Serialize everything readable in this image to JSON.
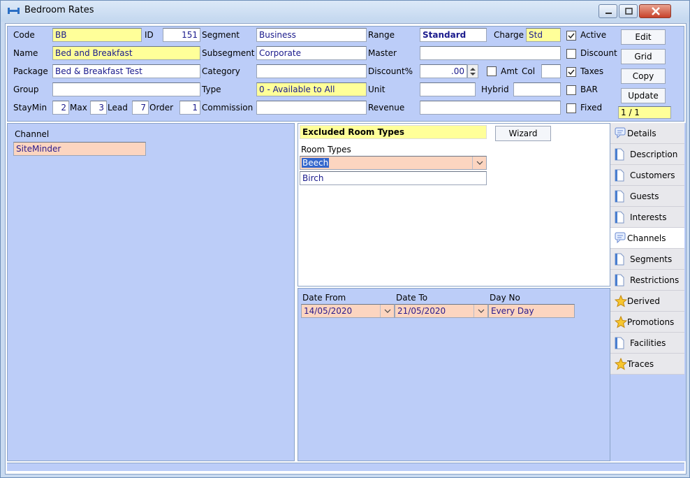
{
  "window": {
    "title": "Bedroom Rates"
  },
  "form": {
    "code_label": "Code",
    "code": "BB",
    "id_label": "ID",
    "id": "151",
    "name_label": "Name",
    "name": "Bed and Breakfast",
    "package_label": "Package",
    "package": "Bed & Breakfast Test",
    "group_label": "Group",
    "group": "",
    "staymin_label": "StayMin",
    "staymin": "2",
    "max_label": "Max",
    "max": "3",
    "lead_label": "Lead",
    "lead": "7",
    "order_label": "Order",
    "order": "1",
    "segment_label": "Segment",
    "segment": "Business",
    "subsegment_label": "Subsegment",
    "subsegment": "Corporate",
    "category_label": "Category",
    "category": "",
    "type_label": "Type",
    "type": "0 - Available to All",
    "commission_label": "Commission",
    "commission": "",
    "range_label": "Range",
    "range": "Standard",
    "charge_label": "Charge",
    "charge": "Std",
    "master_label": "Master",
    "master": "",
    "discount_pct_label": "Discount%",
    "discount_pct": ".00",
    "amt_label": "Amt",
    "col_label": "Col",
    "col": "",
    "unit_label": "Unit",
    "unit": "",
    "hybrid_label": "Hybrid",
    "hybrid": "",
    "revenue_label": "Revenue",
    "revenue": ""
  },
  "checks": [
    {
      "label": "Active",
      "checked": true
    },
    {
      "label": "Discount",
      "checked": false
    },
    {
      "label": "Taxes",
      "checked": true
    },
    {
      "label": "BAR",
      "checked": false
    },
    {
      "label": "Fixed",
      "checked": false
    }
  ],
  "buttons": {
    "edit": "Edit",
    "grid": "Grid",
    "copy": "Copy",
    "update": "Update",
    "record_count": "1 / 1"
  },
  "channels": {
    "header": "Channel",
    "items": [
      "SiteMinder"
    ]
  },
  "excluded": {
    "title": "Excluded Room Types",
    "wizard": "Wizard",
    "room_types_label": "Room Types",
    "room_types": [
      "Beech",
      "Birch"
    ]
  },
  "dates": {
    "from_label": "Date From",
    "to_label": "Date To",
    "dayno_label": "Day No",
    "from": "14/05/2020",
    "to": "21/05/2020",
    "dayno": "Every Day"
  },
  "tabs": [
    {
      "label": "Details",
      "icon": "chat-doc-icon"
    },
    {
      "label": "Description",
      "icon": "page-icon"
    },
    {
      "label": "Customers",
      "icon": "page-icon"
    },
    {
      "label": "Guests",
      "icon": "page-icon"
    },
    {
      "label": "Interests",
      "icon": "page-icon"
    },
    {
      "label": "Channels",
      "icon": "chat-doc-icon",
      "active": true
    },
    {
      "label": "Segments",
      "icon": "page-icon"
    },
    {
      "label": "Restrictions",
      "icon": "page-icon"
    },
    {
      "label": "Derived",
      "icon": "star-icon"
    },
    {
      "label": "Promotions",
      "icon": "star-icon"
    },
    {
      "label": "Facilities",
      "icon": "page-icon"
    },
    {
      "label": "Traces",
      "icon": "star-icon"
    }
  ],
  "colors": {
    "panel": "#bccdf8",
    "highlight": "#ffff99",
    "selected": "#fcd5c0",
    "text_value": "#1a1a8c"
  }
}
